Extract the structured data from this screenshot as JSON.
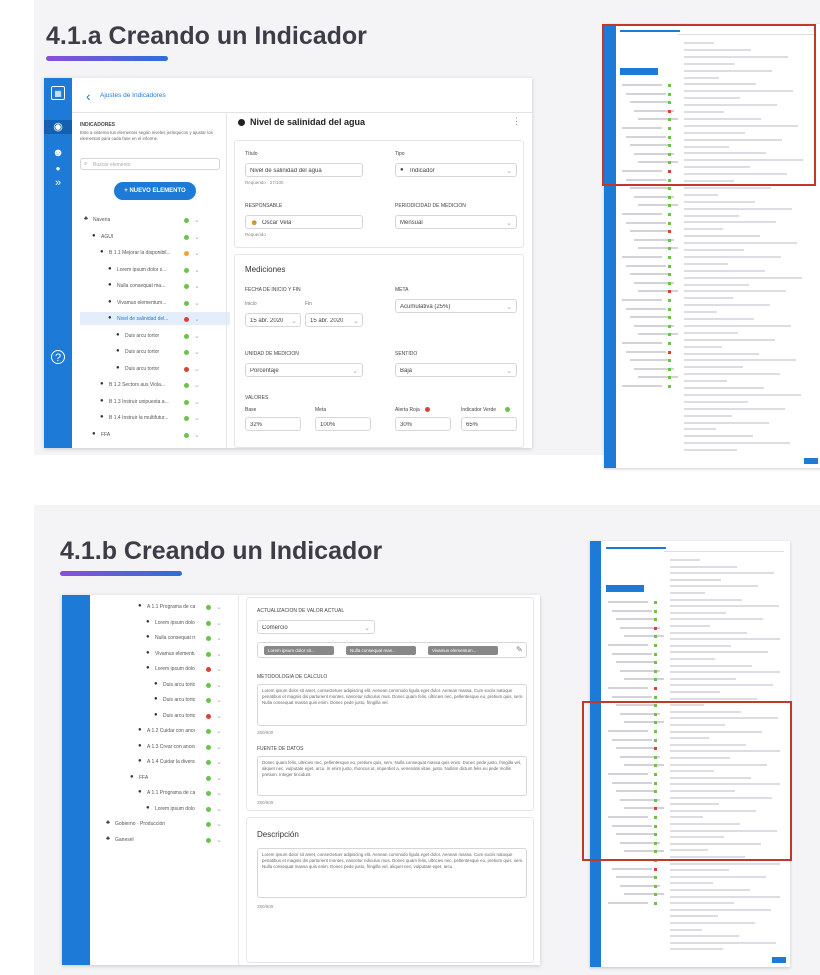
{
  "slide1": {
    "title": "4.1.a Creando un Indicador",
    "back_title": "Ajustes de Indicadores",
    "sidebar_heading": "INDICADORES",
    "sidebar_desc": "Este a sistema tus elementos según niveles jerárquicos y ajustar los elementos para cada fase en el informe.",
    "search_placeholder": "Buscar elemento",
    "new_button": "+ NUEVO ELEMENTO",
    "tree": [
      {
        "label": "Naveria",
        "status": "g"
      },
      {
        "label": "AGUI",
        "status": "g"
      },
      {
        "label": "B 1.1 Mejorar la disponibil...",
        "status": "o"
      },
      {
        "label": "Lorem ipsum dolor s...",
        "status": "g"
      },
      {
        "label": "Nulla consequat ma...",
        "status": "g"
      },
      {
        "label": "Vivamus elementum...",
        "status": "g"
      },
      {
        "label": "Nivel de salinidad del...",
        "status": "r"
      },
      {
        "label": "Duis arcu tortor",
        "status": "g"
      },
      {
        "label": "Duis arcu tortor",
        "status": "g"
      },
      {
        "label": "Duis arcu tortor",
        "status": "r"
      },
      {
        "label": "B 1.2 Sectors aus Viola...",
        "status": "g"
      },
      {
        "label": "B 1.3 Instruir unipuesta a...",
        "status": "g"
      },
      {
        "label": "B 1.4 Instruir la multifutur...",
        "status": "g"
      },
      {
        "label": "FFA",
        "status": "g"
      }
    ],
    "panel_title": "Nivel de salinidad del agua",
    "f_title_label": "Título",
    "f_title_value": "Nivel de salinidad del agua",
    "f_title_help": "Requerido · 27/100",
    "f_type_label": "Tipo",
    "f_type_value": "Indicador",
    "f_resp_label": "RESPONSABLE",
    "f_resp_value": "Oscar Vela",
    "f_resp_help": "Requerido",
    "f_freq_label": "PERIODICIDAD DE MEDICIÓN",
    "f_freq_value": "Mensual",
    "meas_title": "Mediciones",
    "f_start_label": "FECHA DE INICIO Y FIN",
    "f_start_sub": "Inicio",
    "f_end_sub": "Fin",
    "f_start_value": "15 abr. 2020",
    "f_end_value": "15 abr. 2020",
    "f_goal_label": "META",
    "f_goal_value": "Acumulativa (25%)",
    "f_unit_label": "UNIDAD DE MEDICIÓN",
    "f_unit_value": "Porcentaje",
    "f_sense_label": "SENTIDO",
    "f_sense_value": "Baja",
    "f_values_label": "VALORES",
    "v_base_l": "Base",
    "v_base_v": "32%",
    "v_meta_l": "Meta",
    "v_meta_v": "100%",
    "v_red_l": "Alerta Roja",
    "v_red_v": "30%",
    "v_green_l": "Indicador Verde",
    "v_green_v": "65%"
  },
  "slide2": {
    "title": "4.1.b Creando un Indicador",
    "tree": [
      {
        "label": "A 1.1 Programa de capaci...",
        "status": "g"
      },
      {
        "label": "Lorem ipsum dolor s...",
        "status": "g"
      },
      {
        "label": "Nulla consequat ma...",
        "status": "g"
      },
      {
        "label": "Vivamus elementum...",
        "status": "g"
      },
      {
        "label": "Lorem ipsum dolor s...",
        "status": "r"
      },
      {
        "label": "Duis arcu tortor",
        "status": "g"
      },
      {
        "label": "Duis arcu tortor",
        "status": "g"
      },
      {
        "label": "Duis arcu tortor",
        "status": "r"
      },
      {
        "label": "A 1.2 Cuidar con ancestr...",
        "status": "g"
      },
      {
        "label": "A 1.3 Crear con ancestr...",
        "status": "g"
      },
      {
        "label": "A 1.4 Cuidar la diversi...",
        "status": "g"
      },
      {
        "label": "FFA",
        "status": "g"
      },
      {
        "label": "A 1.1 Programa de capaci...",
        "status": "g"
      },
      {
        "label": "Lorem ipsum dolor s...",
        "status": "g"
      },
      {
        "label": "Gobierno · Producción",
        "status": "g"
      },
      {
        "label": "Ganesel",
        "status": "g"
      }
    ],
    "update_label": "ACTUALIZACIÓN DE VALOR ACTUAL",
    "update_value": "Comercio",
    "chips": [
      "Lorem ipsum dolor sit...",
      "Nulla consequat mas...",
      "Vivamus elementum..."
    ],
    "method_label": "METODOLOGÍA DE CÁLCULO",
    "method_text": "Lorem ipsum dolor sit amet, consectetuer adipiscing elit. Aenean commodo ligula eget dolor. Aenean massa. Cum sociis natoque penatibus et magnis dis parturient montes, nascetur ridiculus mus. Donec quam felis, ultricies nec, pellentesque eu, pretium quis, sem. Nulla consequat massa quis enim. Donec pede justo, fringilla vel.",
    "source_label": "FUENTE DE DATOS",
    "source_text": "Donec quam felis, ultricies nec, pellentesque eu, pretium quis, sem. Nulla consequat massa quis enim. Donec pede justo, fringilla vel, aliquet nec, vulputate eget, arcu. In enim justo, rhoncus ut, imperdiet a, venenatis vitae, justo. Nullam dictum felis eu pede mollis pretium. Integer tincidunt.",
    "count_a": "280/500",
    "count_b": "280/500",
    "count_c": "280/500",
    "desc_title": "Descripción",
    "desc_text": "Lorem ipsum dolor sit amet, consectetuer adipiscing elit. Aenean commodo ligula eget dolor. Aenean massa. Cum sociis natoque penatibus et magnis dis parturient montes, nascetur ridiculus mus. Donec quam felis, ultricies nec, pellentesque eu, pretium quis, sem. Nulla consequat massa quis enim. Donec pede justo, fringilla vel, aliquet nec, vulputate eget, arcu."
  }
}
